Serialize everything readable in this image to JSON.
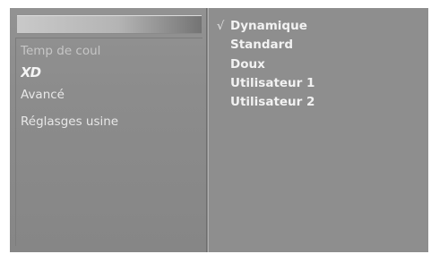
{
  "left_menu": {
    "items": [
      {
        "label": "Temp de coul"
      },
      {
        "label": "XD",
        "icon": "xd-logo-icon"
      },
      {
        "label": "Avancé"
      },
      {
        "label": "Réglasges usine"
      }
    ]
  },
  "right_menu": {
    "check_icon": "√",
    "selected_index": 0,
    "options": [
      {
        "label": "Dynamique"
      },
      {
        "label": "Standard"
      },
      {
        "label": "Doux"
      },
      {
        "label": "Utilisateur 1"
      },
      {
        "label": "Utilisateur 2"
      }
    ]
  },
  "colors": {
    "panel_bg": "#8a8a8a",
    "text": "#f2f2f2"
  }
}
